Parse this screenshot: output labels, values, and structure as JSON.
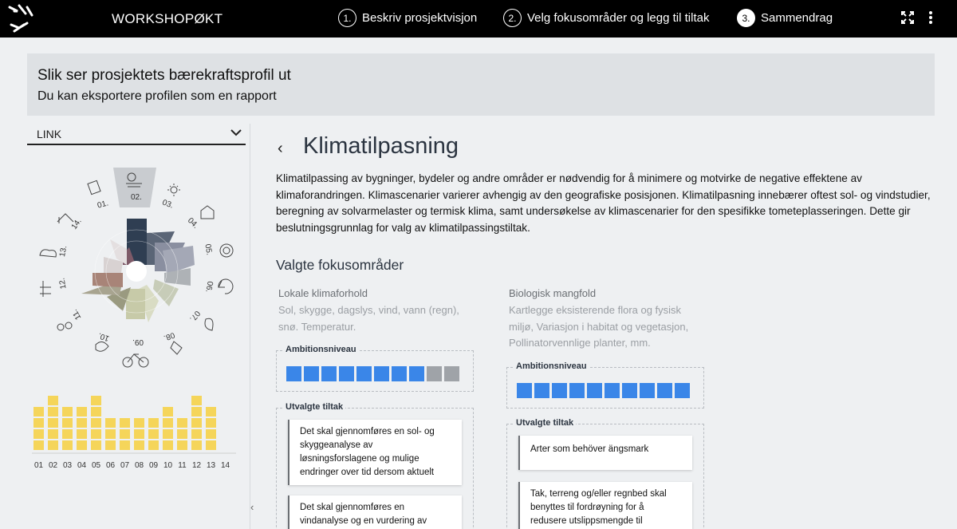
{
  "topbar": {
    "app_title": "WORKSHOPØKT",
    "steps": [
      {
        "num": "1.",
        "label": "Beskriv prosjektvisjon"
      },
      {
        "num": "2.",
        "label": "Velg fokusområder og legg til tiltak"
      },
      {
        "num": "3.",
        "label": "Sammendrag"
      }
    ],
    "icons": [
      "fullscreen-icon",
      "more-vertical-icon"
    ]
  },
  "banner": {
    "title": "Slik ser prosjektets bærekraftsprofil ut",
    "subtitle": "Du kan eksportere profilen som en rapport"
  },
  "left_panel": {
    "project_select": "LINK",
    "wheel_labels": [
      "01.",
      "02.",
      "03.",
      "04.",
      "05.",
      "06.",
      "07.",
      "08.",
      "09.",
      "10.",
      "11.",
      "12.",
      "13.",
      "14."
    ],
    "bar_labels": [
      "01",
      "02",
      "03",
      "04",
      "05",
      "06",
      "07",
      "08",
      "09",
      "10",
      "11",
      "12",
      "13",
      "14"
    ],
    "bar_values": [
      4,
      5,
      4,
      4,
      5,
      3,
      3,
      3,
      3,
      4,
      3,
      5,
      4,
      0
    ],
    "bar_color": "#f5d55a"
  },
  "main": {
    "title": "Klimatilpasning",
    "description": "Klimatilpassing av bygninger, bydeler og andre områder er nødvendig for å minimere og motvirke de negative effektene av klimaforandringen. Klimascenarier varierer avhengig av den geografiske posisjonen. Klimatilpasning innebærer oftest sol- og vindstudier, beregning av solvarmelaster og termisk klima, samt undersøkelse av klimascenarier for den spesifikke tometeplasseringen. Dette gir beslutningsgrunnlag for valg av klimatilpassingstiltak.",
    "section_title": "Valgte fokusområder",
    "focus_areas": [
      {
        "name": "Lokale klimaforhold",
        "description": "Sol, skygge, dagslys, vind, vann (regn), snø. Temperatur.",
        "ambition_label": "Ambitionsniveau",
        "ambition_level": 8,
        "ambition_max": 10,
        "measures_label": "Utvalgte tiltak",
        "measures": [
          "Det skal gjennomføres en sol- og skyggeanalyse av løsningsforslagene og mulige endringer over tid dersom aktuelt",
          "Det skal gjennomføres en vindanalyse og en vurdering av"
        ]
      },
      {
        "name": "Biologisk mangfold",
        "description": "Kartlegge eksisterende flora og fysisk miljø, Variasjon i habitat og vegetasjon, Pollinatorvennlige planter, mm.",
        "ambition_label": "Ambitionsniveau",
        "ambition_level": 10,
        "ambition_max": 10,
        "measures_label": "Utvalgte tiltak",
        "measures": [
          "Arter som behöver ängsmark",
          "Tak, terreng og/eller regnbed skal benyttes til fordrøyning for å redusere utslippsmengde til"
        ]
      }
    ],
    "accent_color": "#3a86e8"
  }
}
